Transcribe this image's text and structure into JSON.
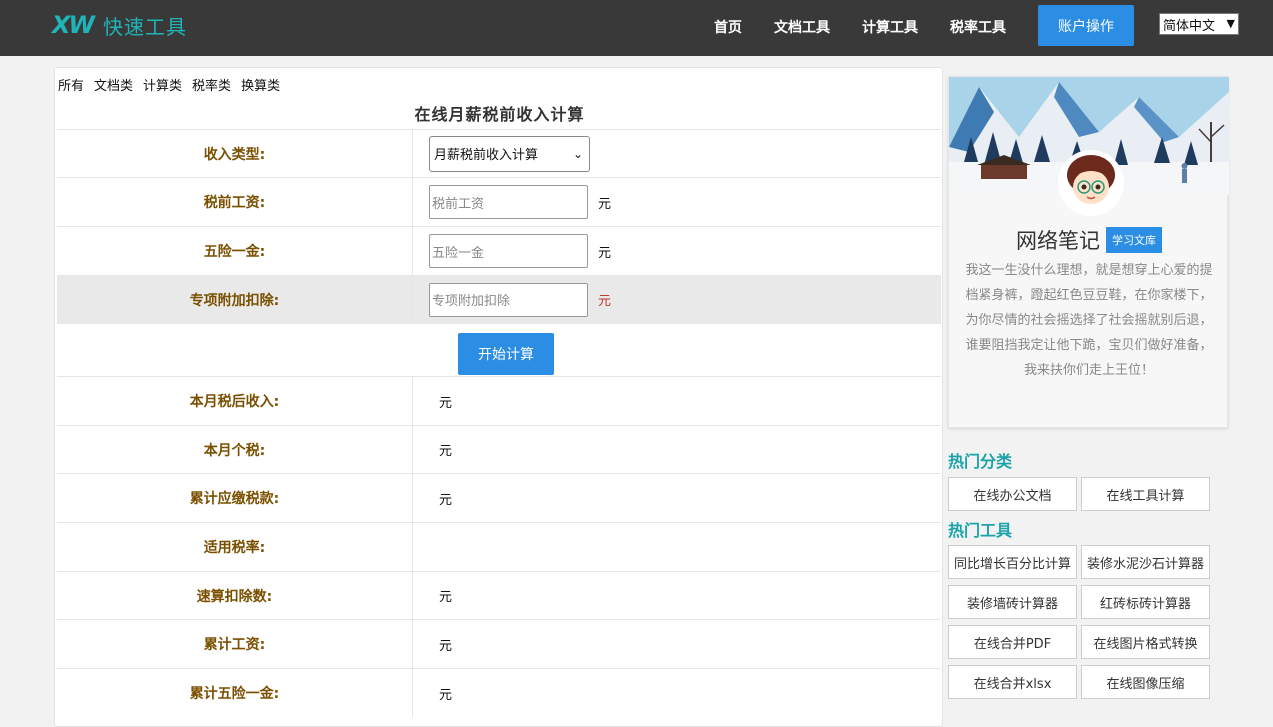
{
  "header": {
    "logo_mark": "XW",
    "logo_text": "快速工具",
    "nav": [
      "首页",
      "文档工具",
      "计算工具",
      "税率工具"
    ],
    "account_button": "账户操作",
    "language": "简体中文"
  },
  "main": {
    "categories": [
      "所有",
      "文档类",
      "计算类",
      "税率类",
      "换算类"
    ],
    "title": "在线月薪税前收入计算",
    "income_type": {
      "label": "收入类型:",
      "selected": "月薪税前收入计算"
    },
    "pretax": {
      "label": "税前工资:",
      "placeholder": "税前工资",
      "unit": "元"
    },
    "insurance": {
      "label": "五险一金:",
      "placeholder": "五险一金",
      "unit": "元"
    },
    "deduction": {
      "label": "专项附加扣除:",
      "placeholder": "专项附加扣除",
      "unit": "元"
    },
    "calc_button": "开始计算",
    "results": [
      {
        "label": "本月税后收入:",
        "unit": "元"
      },
      {
        "label": "本月个税:",
        "unit": "元"
      },
      {
        "label": "累计应缴税款:",
        "unit": "元"
      },
      {
        "label": "适用税率:",
        "unit": ""
      },
      {
        "label": "速算扣除数:",
        "unit": "元"
      },
      {
        "label": "累计工资:",
        "unit": "元"
      },
      {
        "label": "累计五险一金:",
        "unit": "元"
      }
    ]
  },
  "sidebar": {
    "profile_name": "网络笔记",
    "profile_tag": "学习文库",
    "bio": "我这一生没什么理想，就是想穿上心爱的提档紧身裤，蹬起红色豆豆鞋，在你家楼下，为你尽情的社会摇选择了社会摇就别后退，谁要阻挡我定让他下跪，宝贝们做好准备，我来扶你们走上王位！",
    "hot_categories_title": "热门分类",
    "hot_categories": [
      "在线办公文档",
      "在线工具计算"
    ],
    "hot_tools_title": "热门工具",
    "hot_tools": [
      "同比增长百分比计算",
      "装修水泥沙石计算器",
      "装修墙砖计算器",
      "红砖标砖计算器",
      "在线合并PDF",
      "在线图片格式转换",
      "在线合并xlsx",
      "在线图像压缩"
    ]
  }
}
